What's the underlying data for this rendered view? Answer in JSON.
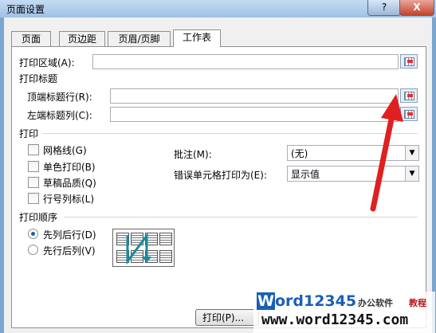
{
  "window": {
    "title": "页面设置",
    "help": "?",
    "close": "X"
  },
  "tabs": [
    "页面",
    "页边距",
    "页眉/页脚",
    "工作表"
  ],
  "print_area": {
    "label": "打印区域(A):",
    "value": ""
  },
  "print_titles": {
    "heading": "打印标题",
    "top_rows": {
      "label": "顶端标题行(R):",
      "value": ""
    },
    "left_cols": {
      "label": "左端标题列(C):",
      "value": ""
    }
  },
  "print": {
    "heading": "打印",
    "options": [
      {
        "label": "网格线(G)",
        "checked": false
      },
      {
        "label": "单色打印(B)",
        "checked": false
      },
      {
        "label": "草稿品质(Q)",
        "checked": false
      },
      {
        "label": "行号列标(L)",
        "checked": false
      }
    ],
    "comments": {
      "label": "批注(M):",
      "value": "(无)"
    },
    "cell_errors": {
      "label": "错误单元格打印为(E):",
      "value": "显示值"
    }
  },
  "page_order": {
    "heading": "打印顺序",
    "options": [
      {
        "label": "先列后行(D)",
        "selected": true
      },
      {
        "label": "先行后列(V)",
        "selected": false
      }
    ]
  },
  "buttons": {
    "print": "打印(P)..."
  },
  "watermark": {
    "brand_w": "W",
    "brand_rest": "ord12345",
    "tag1": "办公软件",
    "tag2": "教程",
    "url": "www.word12345.com"
  },
  "colors": {
    "arrow": "#e02020",
    "accent": "#1a5fb4"
  }
}
